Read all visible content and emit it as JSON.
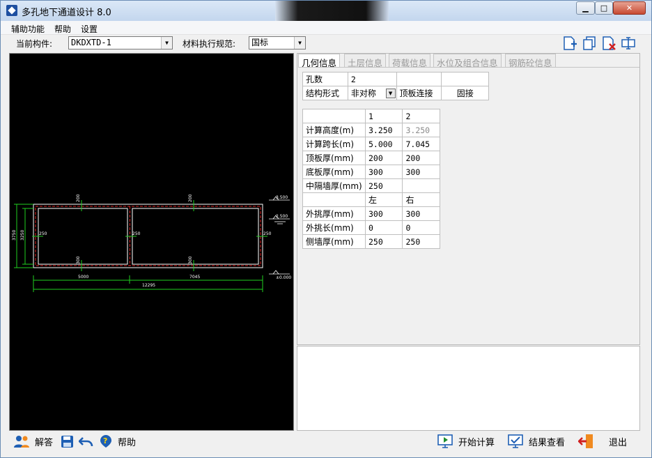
{
  "window": {
    "title": "多孔地下通道设计 8.0"
  },
  "menu": [
    "辅助功能",
    "帮助",
    "设置"
  ],
  "toolbar": {
    "component_label": "当前构件:",
    "component_value": "DKDXTD-1",
    "code_label": "材料执行规范:",
    "code_value": "国标"
  },
  "tabs": [
    "几何信息",
    "土层信息",
    "荷载信息",
    "水位及组合信息",
    "钢筋砼信息"
  ],
  "basic": {
    "holes_label": "孔数",
    "holes_value": "2",
    "form_label": "结构形式",
    "form_value": "非对称",
    "top_conn_label": "顶板连接",
    "top_conn_value": "固接"
  },
  "geometry": {
    "col_headers": [
      "1",
      "2"
    ],
    "rows": [
      {
        "label": "计算高度(m)",
        "v1": "3.250",
        "v2": "3.250"
      },
      {
        "label": "计算跨长(m)",
        "v1": "5.000",
        "v2": "7.045"
      },
      {
        "label": "顶板厚(mm)",
        "v1": "200",
        "v2": "200"
      },
      {
        "label": "底板厚(mm)",
        "v1": "300",
        "v2": "300"
      },
      {
        "label": "中隔墙厚(mm)",
        "v1": "250",
        "v2": ""
      }
    ],
    "side_headers": [
      "左",
      "右"
    ],
    "side_rows": [
      {
        "label": "外挑厚(mm)",
        "v1": "300",
        "v2": "300"
      },
      {
        "label": "外挑长(mm)",
        "v1": "0",
        "v2": "0"
      },
      {
        "label": "侧墙厚(mm)",
        "v1": "250",
        "v2": "250"
      }
    ]
  },
  "drawing": {
    "top_dim_left": "200",
    "top_dim_right": "200",
    "bot_dim_left": "300",
    "bot_dim_right": "300",
    "wall_left": "250",
    "wall_mid": "250",
    "wall_right": "250",
    "height_outer": "3750",
    "height_inner": "3250",
    "span_left": "5000",
    "span_right": "7045",
    "span_total": "12295",
    "level_top": "3.500",
    "level_water": "2.500",
    "level_base": "±0.000"
  },
  "bottom": {
    "answer": "解答",
    "help": "帮助",
    "start": "开始计算",
    "results": "结果查看",
    "exit": "退出"
  },
  "colors": {
    "accent": "#1e5fb4",
    "drawing_bg": "#000000",
    "drawing_line": "#ffffff",
    "rebar": "#e02020",
    "dim": "#20d020"
  }
}
